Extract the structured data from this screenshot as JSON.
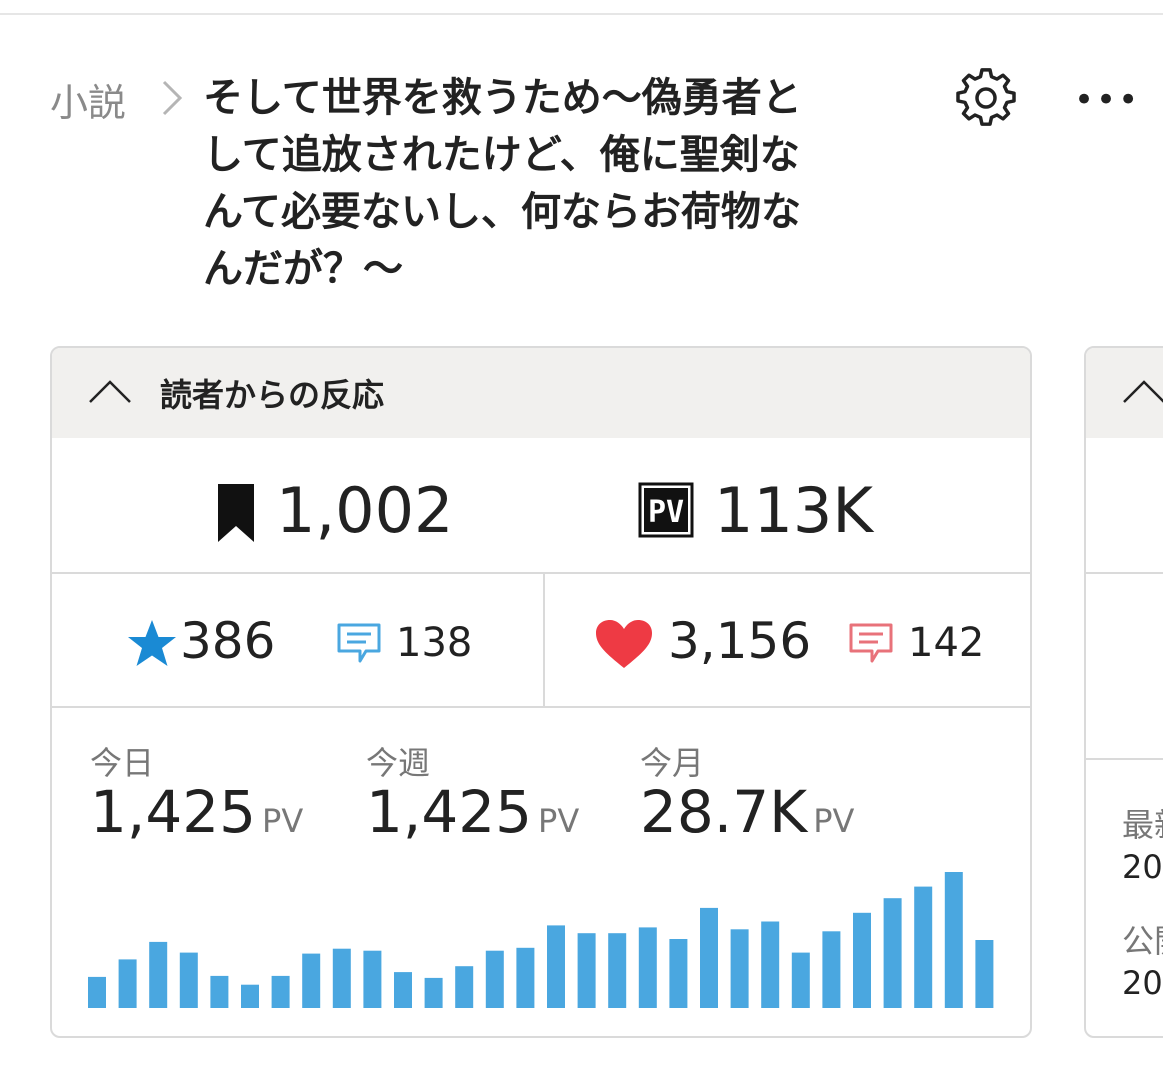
{
  "header": {
    "breadcrumb": "小説",
    "title_lines": [
      "そして世界を救うため〜偽勇者と",
      "して追放されたけど、俺に聖剣な",
      "んて必要ないし、何ならお荷物な",
      "んだが？〜"
    ],
    "more_label": "•••"
  },
  "reactions": {
    "heading": "読者からの反応",
    "bookmarks": "1,002",
    "pv_icon_label": "PV",
    "pv_total": "113K",
    "stars": "386",
    "star_comments": "138",
    "hearts": "3,156",
    "heart_comments": "142",
    "stats": [
      {
        "label": "今日",
        "value": "1,425",
        "unit": "PV"
      },
      {
        "label": "今週",
        "value": "1,425",
        "unit": "PV"
      },
      {
        "label": "今月",
        "value": "28.7K",
        "unit": "PV"
      }
    ]
  },
  "side_card": {
    "label1": "最新",
    "value1": "20",
    "label2": "公開",
    "value2": "20"
  },
  "colors": {
    "accent_blue": "#4aa7e0",
    "star_blue": "#1a8ad4",
    "heart_red": "#ee3a44",
    "comment_red": "#e8727a"
  },
  "chart_data": {
    "type": "bar",
    "title": "",
    "xlabel": "",
    "ylabel": "",
    "ylim": [
      0,
      140
    ],
    "values": [
      32,
      50,
      68,
      57,
      33,
      24,
      33,
      56,
      61,
      59,
      37,
      31,
      43,
      59,
      62,
      85,
      77,
      77,
      83,
      71,
      103,
      81,
      89,
      57,
      79,
      98,
      113,
      125,
      140,
      70
    ]
  }
}
